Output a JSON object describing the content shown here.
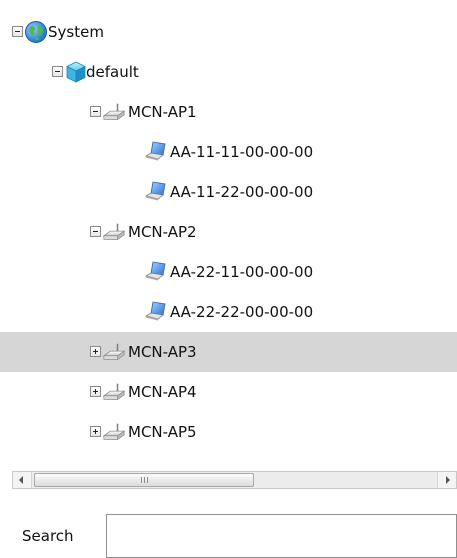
{
  "tree": {
    "system": {
      "label": "System",
      "icon": "globe-icon",
      "expanded": true
    },
    "default": {
      "label": "default",
      "icon": "cube-icon",
      "expanded": true
    },
    "access_points": [
      {
        "label": "MCN-AP1",
        "icon": "access-point-icon",
        "expanded": true,
        "clients": [
          "AA-11-11-00-00-00",
          "AA-11-22-00-00-00"
        ]
      },
      {
        "label": "MCN-AP2",
        "icon": "access-point-icon",
        "expanded": true,
        "clients": [
          "AA-22-11-00-00-00",
          "AA-22-22-00-00-00"
        ]
      },
      {
        "label": "MCN-AP3",
        "icon": "access-point-icon",
        "expanded": false,
        "selected": true
      },
      {
        "label": "MCN-AP4",
        "icon": "access-point-icon",
        "expanded": false
      },
      {
        "label": "MCN-AP5",
        "icon": "access-point-icon",
        "expanded": false
      }
    ],
    "client_icon": "laptop-icon"
  },
  "search": {
    "label": "Search",
    "value": "",
    "placeholder": ""
  },
  "colors": {
    "selection": "#d6d6d6"
  }
}
